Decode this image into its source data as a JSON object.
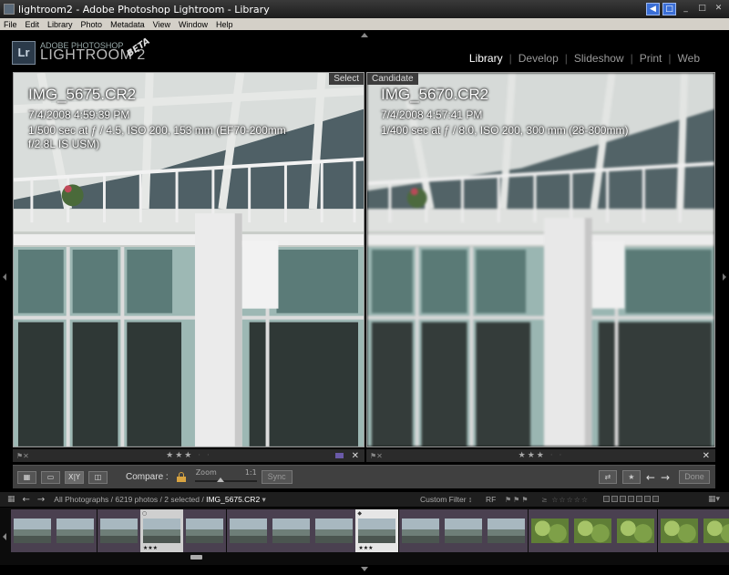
{
  "window": {
    "title": "lightroom2 - Adobe Photoshop Lightroom - Library",
    "controls": [
      "minimize",
      "maximize",
      "close"
    ]
  },
  "menu": [
    "File",
    "Edit",
    "Library",
    "Photo",
    "Metadata",
    "View",
    "Window",
    "Help"
  ],
  "brand": {
    "logo": "Lr",
    "line1": "ADOBE PHOTOSHOP",
    "line2": "LIGHTROOM 2",
    "badge": "BETA"
  },
  "modules": [
    {
      "label": "Library",
      "active": true
    },
    {
      "label": "Develop",
      "active": false
    },
    {
      "label": "Slideshow",
      "active": false
    },
    {
      "label": "Print",
      "active": false
    },
    {
      "label": "Web",
      "active": false
    }
  ],
  "select_photo": {
    "tag": "Select",
    "name": "IMG_5675.CR2",
    "date": "7/4/2008 4:59:39 PM",
    "exif": "1/500 sec at ƒ / 4.5, ISO 200, 153 mm (EF70-200mm f/2.8L IS USM)",
    "stars": "★★★",
    "stars_empty": "· ·",
    "rating": 3,
    "color_label": "#6a5aa8"
  },
  "candidate_photo": {
    "tag": "Candidate",
    "name": "IMG_5670.CR2",
    "date": "7/4/2008 4:57:41 PM",
    "exif": "1/400 sec at ƒ / 8.0, ISO 200, 300 mm (28-300mm)",
    "stars": "★★★",
    "stars_empty": "· ·",
    "rating": 3
  },
  "toolbar": {
    "compare_label": "Compare :",
    "zoom_label": "Zoom",
    "zoom_value": "1:1",
    "sync_label": "Sync",
    "done_label": "Done",
    "view_modes": [
      "grid",
      "loupe",
      "compare",
      "survey"
    ],
    "compare_mode_label": "X|Y"
  },
  "filmstrip_bar": {
    "path_prefix": "All Photographs / 6219 photos / 2 selected / ",
    "current_file": "IMG_5675.CR2",
    "filter_label": "Custom Filter ↕",
    "rf_label": "RF",
    "flags": "⚑⚑⚑",
    "stars_filter": "≥ ☆☆☆☆☆"
  },
  "filmstrip": [
    {
      "kind": "building",
      "state": "normal"
    },
    {
      "kind": "building",
      "state": "normal"
    },
    {
      "kind": "building",
      "state": "normal"
    },
    {
      "kind": "building",
      "state": "selected",
      "stars": "★★★"
    },
    {
      "kind": "building",
      "state": "normal"
    },
    {
      "kind": "building",
      "state": "normal"
    },
    {
      "kind": "building",
      "state": "normal"
    },
    {
      "kind": "building",
      "state": "normal"
    },
    {
      "kind": "building",
      "state": "selected",
      "stars": "★★★"
    },
    {
      "kind": "building",
      "state": "normal"
    },
    {
      "kind": "building",
      "state": "normal"
    },
    {
      "kind": "building",
      "state": "normal"
    },
    {
      "kind": "foliage",
      "state": "normal"
    },
    {
      "kind": "foliage",
      "state": "normal"
    },
    {
      "kind": "foliage",
      "state": "normal"
    },
    {
      "kind": "foliage",
      "state": "normal"
    },
    {
      "kind": "foliage",
      "state": "normal"
    }
  ]
}
